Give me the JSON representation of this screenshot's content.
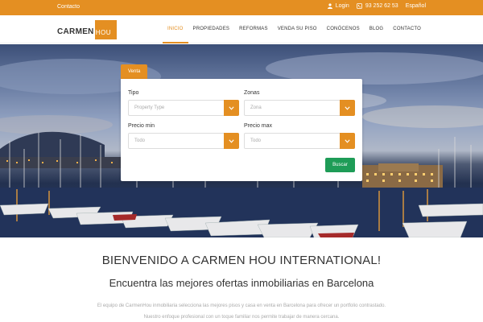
{
  "topbar": {
    "contact": "Contacto",
    "login": "Login",
    "phone": "93 252 62 53",
    "language": "Español"
  },
  "logo": {
    "part1": "CARMEN",
    "part2": "HOU"
  },
  "nav": {
    "items": [
      "INICIO",
      "PROPIEDADES",
      "REFORMAS",
      "VENDA SU PISO",
      "CONÓCENOS",
      "BLOG",
      "CONTACTO"
    ]
  },
  "search": {
    "tab": "Venta",
    "tipo_label": "Tipo",
    "tipo_placeholder": "Property Type",
    "zonas_label": "Zonas",
    "zonas_placeholder": "Zona",
    "precio_min_label": "Precio min",
    "precio_min_value": "Todo",
    "precio_max_label": "Precio max",
    "precio_max_value": "Todo",
    "button": "Buscar"
  },
  "welcome": {
    "title": "BIENVENIDO A CARMEN HOU INTERNATIONAL!",
    "subtitle": "Encuentra las mejores ofertas inmobiliarias en Barcelona",
    "text": "El equipo de CarmenHou inmobiliaria selecciona las mejores pisos y casa en venta en Barcelona para ofrecer un portfolio contrastado. Nuestro enfoque profesional con un toque familiar nos permite trabajar de manera cercana."
  },
  "colors": {
    "accent": "#e48f22",
    "button_green": "#1e9c57"
  }
}
